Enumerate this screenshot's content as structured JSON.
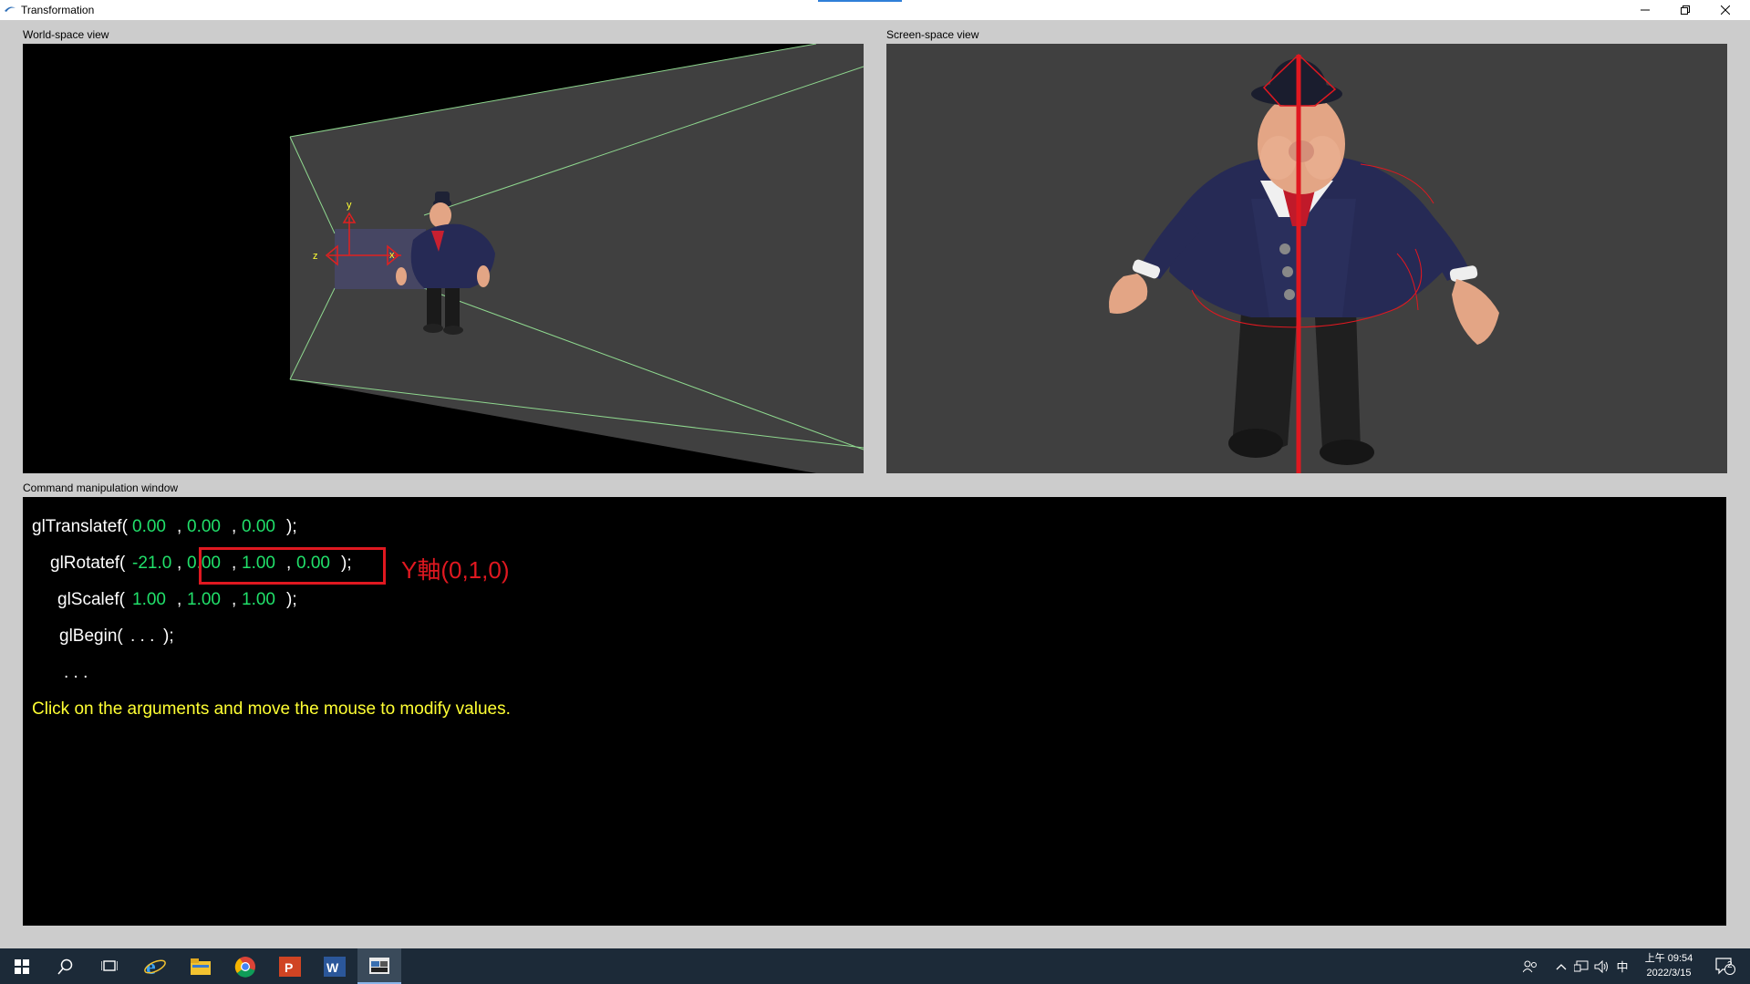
{
  "window": {
    "title": "Transformation"
  },
  "panels": {
    "world_label": "World-space view",
    "screen_label": "Screen-space view",
    "command_label": "Command manipulation window"
  },
  "world_view": {
    "axis_y": "y",
    "axis_z": "z",
    "axis_x": "x"
  },
  "commands": {
    "translate": {
      "name": "glTranslatef(",
      "args": [
        "0.00",
        "0.00",
        "0.00"
      ],
      "end": ");"
    },
    "rotate": {
      "name": "glRotatef(",
      "args": [
        "-21.0",
        "0.00",
        "1.00",
        "0.00"
      ],
      "end": ");"
    },
    "scale": {
      "name": "glScalef(",
      "args": [
        "1.00",
        "1.00",
        "1.00"
      ],
      "end": ");"
    },
    "begin": {
      "name": "glBegin(",
      "inner": ". . .",
      "end": ");"
    },
    "ellipsis": ". . .",
    "hint": "Click on the arguments and move the mouse to modify values.",
    "separator": ","
  },
  "annotation": {
    "text": "Y軸(0,1,0)",
    "color": "#e01820"
  },
  "taskbar": {
    "ime": "中",
    "clock_line1": "上午 09:54",
    "clock_line2": "2022/3/15",
    "notification_count": "2"
  },
  "colors": {
    "value_green": "#21e06a",
    "hint_yellow": "#ffff33",
    "viewport_bg": "#404040",
    "frustum_line": "#8fd88f"
  }
}
